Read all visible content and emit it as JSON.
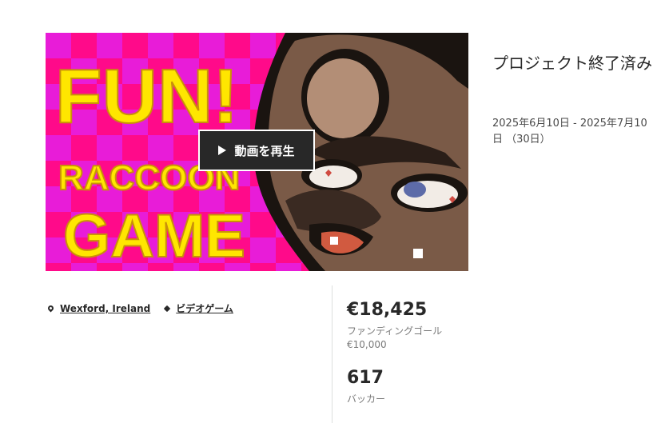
{
  "video": {
    "play_label": "動画を再生",
    "artwork_lettering": [
      "FUN!",
      "RACCOON",
      "GAME"
    ],
    "colors": {
      "checker_a": "#e8188e",
      "checker_b": "#ff0a8a",
      "lettering": "#ffe600",
      "raccoon_fur": "#7a5a47"
    }
  },
  "project": {
    "status": "プロジェクト終了済み",
    "date_range": "2025年6月10日 - 2025年7月10日 （30日）"
  },
  "meta": {
    "location": "Wexford, Ireland",
    "category": "ビデオゲーム"
  },
  "stats": {
    "pledged": "€18,425",
    "goal_label": "ファンディングゴール",
    "goal_value": "€10,000",
    "backers": "617",
    "backers_label": "バッカー"
  }
}
